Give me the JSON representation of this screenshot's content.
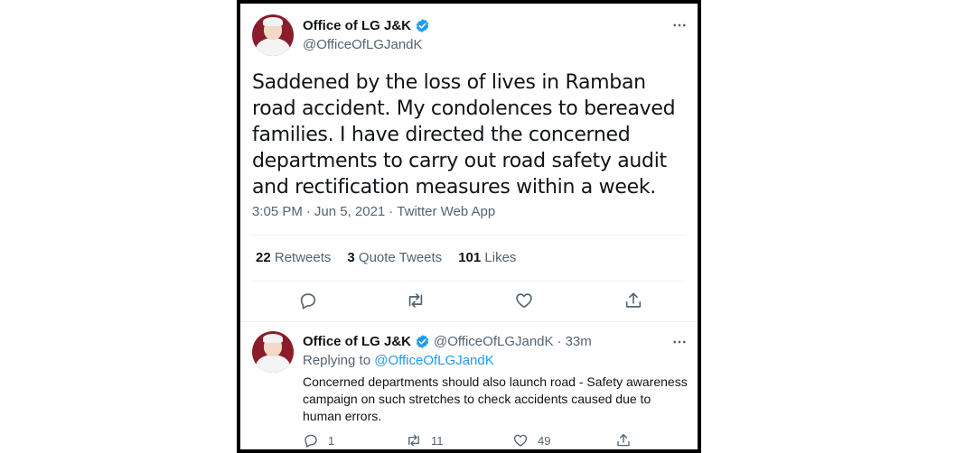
{
  "main_tweet": {
    "author_name": "Office of LG J&K",
    "handle": "@OfficeOfLGJandK",
    "text": "Saddened by the loss of lives in Ramban road accident. My condolences to bereaved families. I have directed the concerned departments to carry out road safety audit and rectification measures within a week.",
    "time": "3:05 PM",
    "date": "Jun 5, 2021",
    "source": "Twitter Web App",
    "separator": "·",
    "stats": {
      "retweets_count": "22",
      "retweets_label": "Retweets",
      "quote_count": "3",
      "quote_label": "Quote Tweets",
      "likes_count": "101",
      "likes_label": "Likes"
    }
  },
  "reply_tweet": {
    "author_name": "Office of LG J&K",
    "handle": "@OfficeOfLGJandK",
    "separator": "·",
    "time": "33m",
    "replying_prefix": "Replying to",
    "replying_to": "@OfficeOfLGJandK",
    "text": "Concerned departments should also launch road - Safety awareness campaign on such stretches to check accidents caused due to human errors.",
    "reply_count": "1",
    "retweet_count": "11",
    "like_count": "49"
  },
  "icons": {
    "verified": "verified-badge-icon",
    "more": "more-dots-icon",
    "reply": "reply-bubble-icon",
    "retweet": "retweet-icon",
    "like": "heart-icon",
    "share": "share-icon"
  },
  "colors": {
    "verified": "#1d9bf0",
    "link": "#1d9bf0",
    "secondary_text": "#536471",
    "frame_border": "#000000",
    "avatar_bg": "#8a1c2b"
  }
}
